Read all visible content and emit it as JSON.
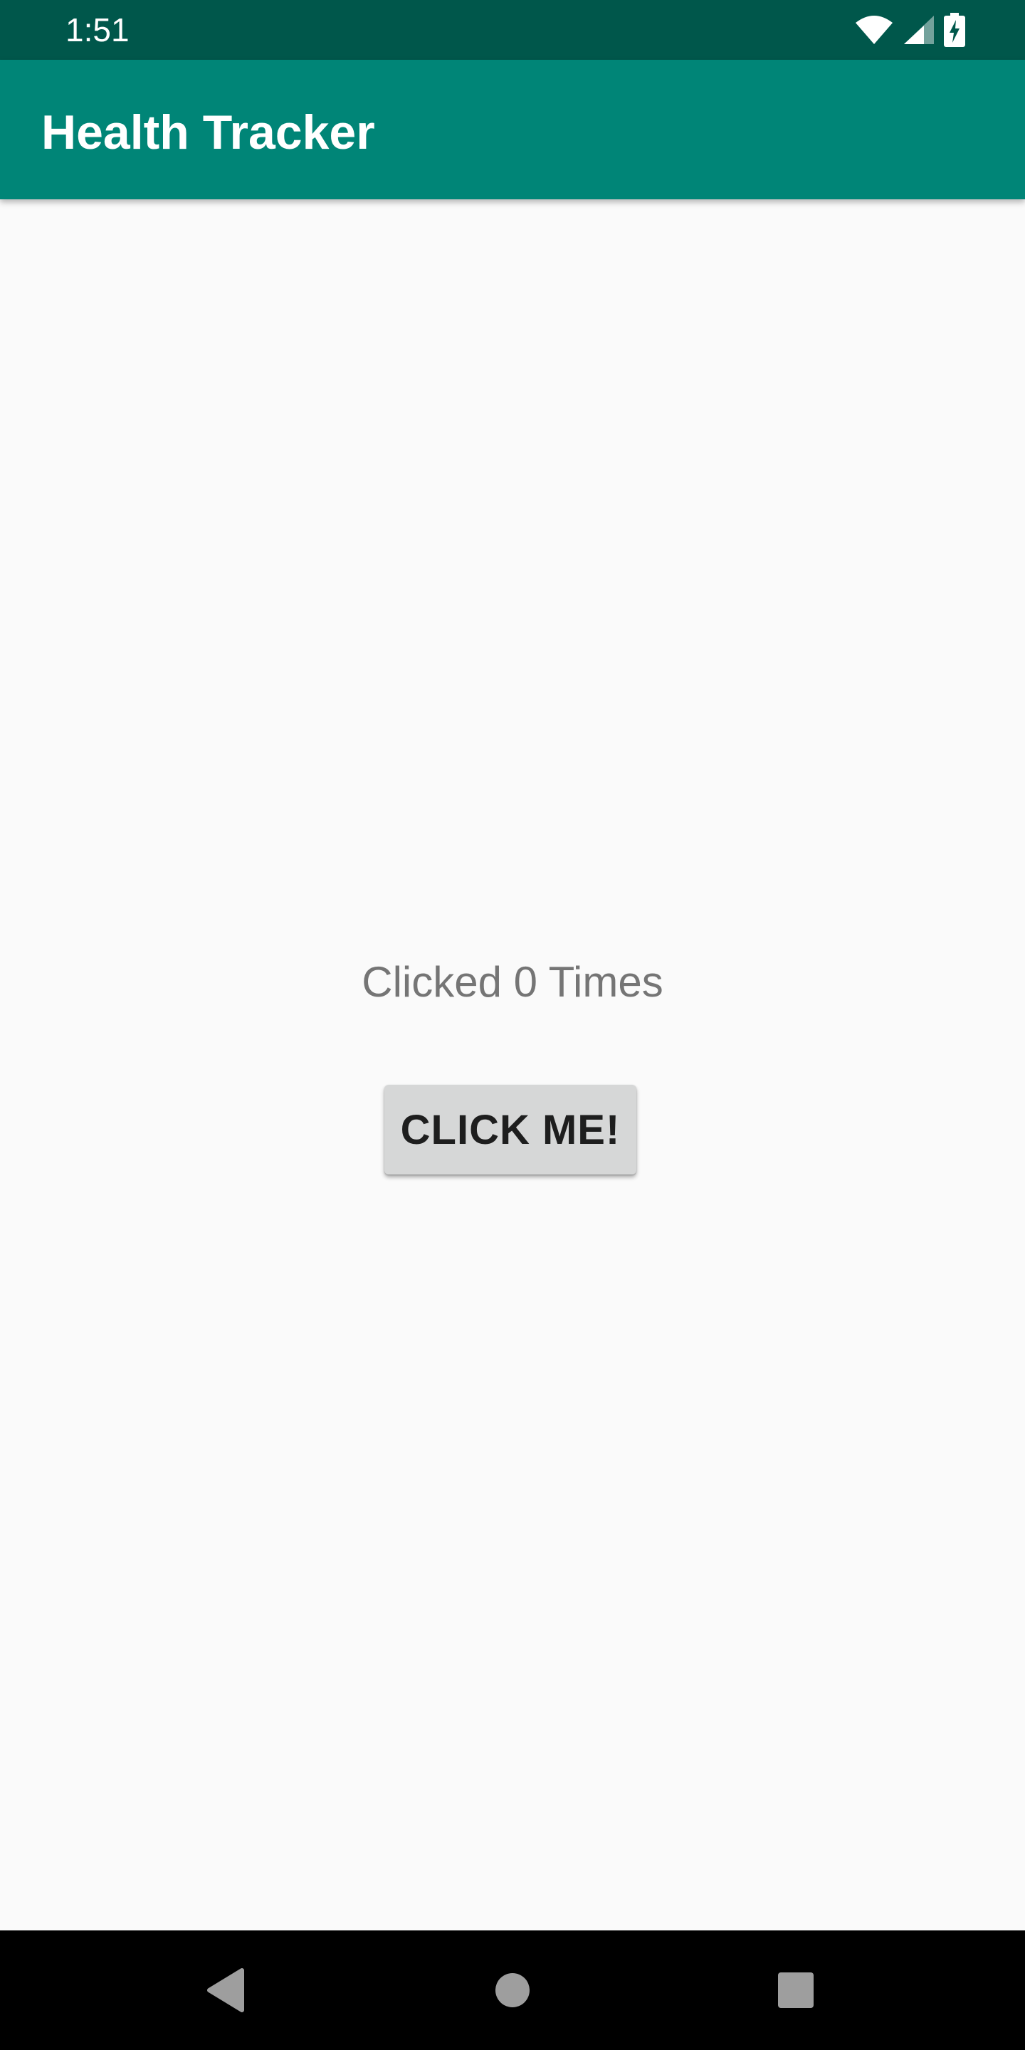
{
  "status_bar": {
    "time": "1:51",
    "icons": [
      "wifi-icon",
      "cellular-signal-icon",
      "battery-charging-icon"
    ]
  },
  "app_bar": {
    "title": "Health Tracker"
  },
  "main": {
    "click_count_text": "Clicked 0 Times",
    "button_label": "CLICK ME!"
  },
  "nav_bar": {
    "icons": [
      "back-icon",
      "home-icon",
      "recents-icon"
    ]
  },
  "colors": {
    "status_bar": "#00574b",
    "app_bar": "#008577",
    "background": "#fafafa",
    "button": "#d6d7d7",
    "text_secondary": "#757575"
  }
}
